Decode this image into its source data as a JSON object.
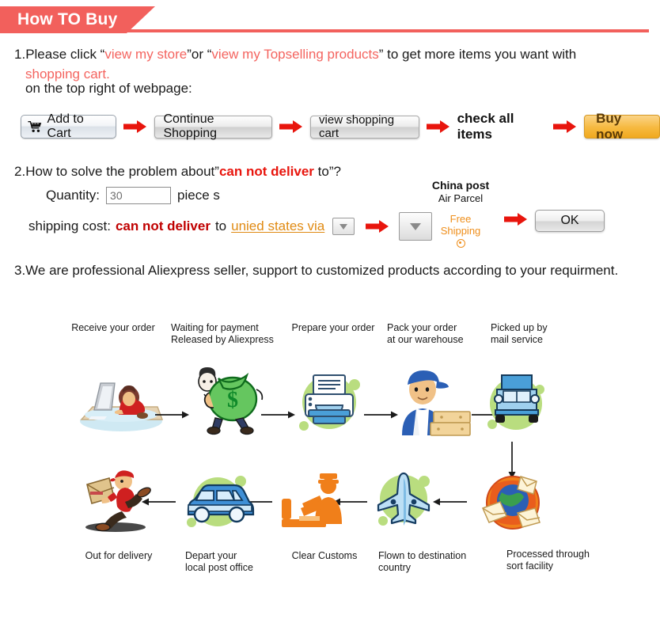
{
  "banner": {
    "title": "How TO Buy",
    "accent": "#f2605c"
  },
  "step1": {
    "num": "1.",
    "text_a": "Please click “",
    "link1": "view my store",
    "text_b": "”or “",
    "link2": "view my Topselling products",
    "text_c": "” to get more items you want with",
    "link3": "shopping cart.",
    "sub": "on the top right of webpage:"
  },
  "buttons": {
    "add_to_cart": "Add to Cart",
    "continue_shopping": "Continue Shopping",
    "view_cart": "view shopping cart",
    "check_all_items": "check all items",
    "buy_now": "Buy now",
    "ok": "OK",
    "cart_icon": "shopping-cart-icon",
    "arrow_icon": "right-arrow-icon"
  },
  "step2": {
    "num": "2.",
    "text_a": "How to solve the problem about”",
    "highlight": "can not deliver",
    "text_b": " to”?",
    "quantity_label": "Quantity:",
    "quantity_value": "30",
    "quantity_placeholder": "30",
    "piece_label": "piece s",
    "shipping_label": "shipping cost:",
    "shipping_highlight": "can not deliver",
    "shipping_to": " to ",
    "country_select": "unied states via",
    "caret_icon": "chevron-down-icon"
  },
  "china_post": {
    "name": "China post",
    "service": "Air Parcel",
    "free_line1": "Free",
    "free_line2": "Shipping",
    "radio": "radio-selected-icon"
  },
  "step3": {
    "text": "3.We are professional Aliexpress seller, support to customized products according to your requirment."
  },
  "flow": {
    "row1": [
      {
        "label": "Receive your order",
        "icon": "person-at-computer-icon"
      },
      {
        "label": "Waiting for payment\nReleased by Aliexpress",
        "icon": "money-bag-icon"
      },
      {
        "label": "Prepare your order",
        "icon": "printer-icon"
      },
      {
        "label": "Pack your order\nat our warehouse",
        "icon": "worker-with-boxes-icon"
      },
      {
        "label": "Picked up by\nmail service",
        "icon": "delivery-truck-icon"
      }
    ],
    "row2": [
      {
        "label": "Out for delivery",
        "icon": "running-courier-icon"
      },
      {
        "label": "Depart your\nlocal post office",
        "icon": "delivery-van-icon"
      },
      {
        "label": "Clear Customs",
        "icon": "customs-officer-icon"
      },
      {
        "label": "Flown to destination\ncountry",
        "icon": "airplane-icon"
      },
      {
        "label": "Processed through\nsort facility",
        "icon": "mail-sorting-icon"
      }
    ]
  },
  "colors": {
    "accent_red": "#f2605c",
    "bright_red": "#e8150d",
    "dark_red": "#c00000",
    "orange": "#ef8f1c",
    "green_blob": "#b9dd7f",
    "buy_now": "#f6b93f"
  }
}
